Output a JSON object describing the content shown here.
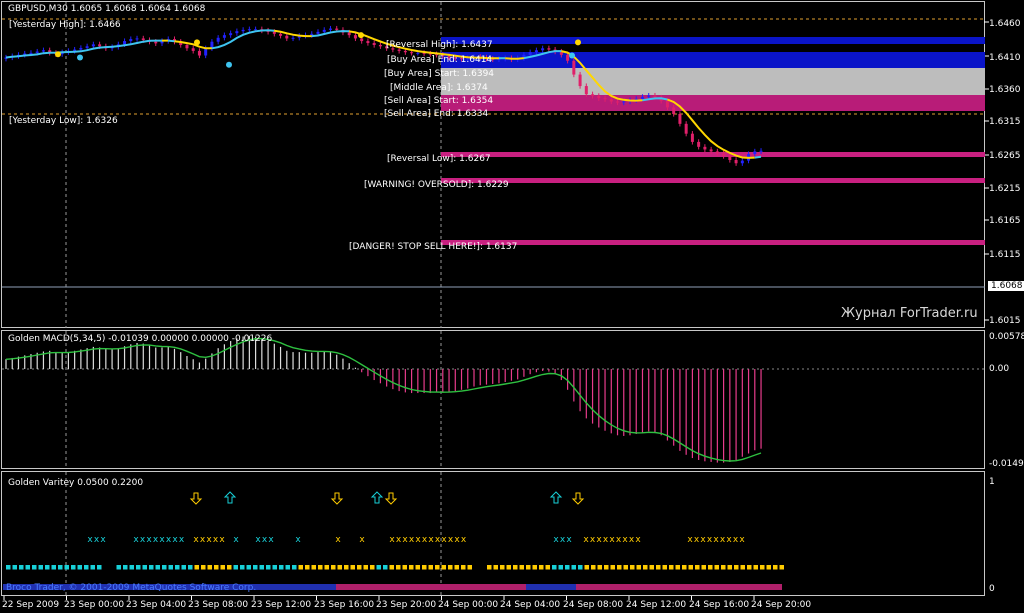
{
  "main_title": "GBPUSD,M30  1.6065 1.6068 1.6064 1.6068",
  "macd_title": "Golden MACD(5,34,5) -0.01039 0.00000 0.00000 -0.01226",
  "variety_title": "Golden Varitey 0.0500 0.2200",
  "watermark": "Журнал ForTrader.ru",
  "copyright": "Broco Trader, © 2001-2009 MetaQuotes Software Corp.",
  "current_price": "1.6068",
  "levels": {
    "yesterday_high": "[Yesterday High]: 1.6466",
    "yesterday_low": "[Yesterday Low]: 1.6326",
    "reversal_high": "[Reversal High]: 1.6437",
    "buy_area_end": "[Buy Area] End: 1.6414",
    "buy_area_start": "[Buy Area] Start: 1.6394",
    "middle_area": "[Middle Area]: 1.6374",
    "sell_area_start": "[Sell Area] Start: 1.6354",
    "sell_area_end": "[Sell Area] End: 1.6334",
    "reversal_low": "[Reversal Low]: 1.6267",
    "warning": "[WARNING! OVERSOLD]: 1.6229",
    "danger": "[DANGER! STOP SELL HERE!]: 1.6137"
  },
  "price_axis": [
    "1.6460",
    "1.6410",
    "1.6360",
    "1.6315",
    "1.6265",
    "1.6215",
    "1.6165",
    "1.6115",
    "1.6015"
  ],
  "macd_axis": [
    "0.00578",
    "0.00",
    "-0.01494"
  ],
  "variety_axis": [
    "1",
    "0"
  ],
  "time_axis": [
    "22 Sep 2009",
    "23 Sep 00:00",
    "23 Sep 04:00",
    "23 Sep 08:00",
    "23 Sep 12:00",
    "23 Sep 16:00",
    "23 Sep 20:00",
    "24 Sep 00:00",
    "24 Sep 04:00",
    "24 Sep 08:00",
    "24 Sep 12:00",
    "24 Sep 16:00",
    "24 Sep 20:00"
  ],
  "colors": {
    "bull": "#2222ff",
    "bear": "#e0206a",
    "ma_yellow": "#ffd700",
    "ma_cyan": "#3ec4f0",
    "macd_pos": "#dddddd",
    "macd_neg": "#e83c8c",
    "signal": "#2ec040",
    "cyan_sq": "#18d0d8",
    "gold_sq": "#ffcc00"
  },
  "chart_data": [
    {
      "type": "candlestick",
      "title": "GBPUSD,M30",
      "ylim": [
        1.6,
        1.648
      ],
      "close": [
        1.6352,
        1.6356,
        1.636,
        1.6364,
        1.6366,
        1.637,
        1.6374,
        1.6366,
        1.6362,
        1.6368,
        1.6372,
        1.6376,
        1.6381,
        1.6386,
        1.6392,
        1.6386,
        1.638,
        1.6384,
        1.6392,
        1.6402,
        1.6408,
        1.641,
        1.6405,
        1.64,
        1.6395,
        1.6402,
        1.6408,
        1.64,
        1.639,
        1.638,
        1.6372,
        1.6358,
        1.638,
        1.64,
        1.6412,
        1.642,
        1.6426,
        1.6432,
        1.6436,
        1.6438,
        1.6438,
        1.6434,
        1.643,
        1.6424,
        1.6418,
        1.641,
        1.6412,
        1.6418,
        1.642,
        1.6424,
        1.643,
        1.6436,
        1.644,
        1.6436,
        1.6428,
        1.642,
        1.641,
        1.6402,
        1.6396,
        1.639,
        1.6386,
        1.638,
        1.6376,
        1.6372,
        1.6368,
        1.6366,
        1.6366,
        1.6364,
        1.6362,
        1.636,
        1.6356,
        1.6352,
        1.635,
        1.6348,
        1.635,
        1.6354,
        1.6352,
        1.6348,
        1.6346,
        1.6348,
        1.635,
        1.6346,
        1.635,
        1.636,
        1.6368,
        1.6374,
        1.638,
        1.6376,
        1.637,
        1.636,
        1.6342,
        1.63,
        1.6265,
        1.624,
        1.6235,
        1.6228,
        1.6225,
        1.6218,
        1.6215,
        1.6218,
        1.6222,
        1.6226,
        1.6232,
        1.6236,
        1.623,
        1.622,
        1.62,
        1.618,
        1.615,
        1.612,
        1.6095,
        1.608,
        1.6072,
        1.6066,
        1.606,
        1.6052,
        1.604,
        1.603,
        1.6038,
        1.6058,
        1.6066,
        1.6068
      ]
    },
    {
      "type": "bar",
      "title": "Golden MACD(5,34,5)",
      "ylim": [
        -0.016,
        0.006
      ],
      "values": [
        0.0015,
        0.0017,
        0.0019,
        0.0021,
        0.0023,
        0.0025,
        0.0027,
        0.0028,
        0.0026,
        0.0025,
        0.0026,
        0.0028,
        0.003,
        0.0032,
        0.0034,
        0.0033,
        0.0031,
        0.003,
        0.0032,
        0.0035,
        0.0038,
        0.004,
        0.0039,
        0.0036,
        0.0033,
        0.0033,
        0.0034,
        0.0031,
        0.0026,
        0.002,
        0.0015,
        0.001,
        0.0016,
        0.0024,
        0.0032,
        0.0038,
        0.0043,
        0.0047,
        0.005,
        0.0051,
        0.005,
        0.0047,
        0.0043,
        0.0039,
        0.0034,
        0.0028,
        0.0026,
        0.0026,
        0.0025,
        0.0025,
        0.0026,
        0.0027,
        0.0026,
        0.0022,
        0.0016,
        0.0009,
        0.0002,
        -0.0005,
        -0.0011,
        -0.0017,
        -0.0022,
        -0.0027,
        -0.0031,
        -0.0034,
        -0.0036,
        -0.0037,
        -0.0037,
        -0.0037,
        -0.0037,
        -0.0036,
        -0.0036,
        -0.0035,
        -0.0034,
        -0.0032,
        -0.003,
        -0.0027,
        -0.0025,
        -0.0024,
        -0.0023,
        -0.0022,
        -0.002,
        -0.0018,
        -0.0016,
        -0.0012,
        -0.0008,
        -0.0005,
        -0.0003,
        -0.0004,
        -0.0008,
        -0.0017,
        -0.0032,
        -0.005,
        -0.0065,
        -0.0076,
        -0.0084,
        -0.009,
        -0.0095,
        -0.0099,
        -0.0102,
        -0.0103,
        -0.0102,
        -0.01,
        -0.0098,
        -0.0096,
        -0.0098,
        -0.0102,
        -0.011,
        -0.0118,
        -0.0126,
        -0.0132,
        -0.0137,
        -0.014,
        -0.0142,
        -0.0143,
        -0.0144,
        -0.0144,
        -0.0143,
        -0.014,
        -0.0135,
        -0.013,
        -0.0125,
        -0.01226
      ]
    }
  ],
  "variety": {
    "up_arrows_x": [
      230,
      377,
      556
    ],
    "down_arrows_x": [
      196,
      337,
      391,
      578
    ],
    "x_marks": [
      {
        "from": 90,
        "to": 104,
        "color": "cyan"
      },
      {
        "from": 136,
        "to": 184,
        "color": "cyan"
      },
      {
        "from": 196,
        "to": 222,
        "color": "gold"
      },
      {
        "from": 236,
        "to": 236,
        "color": "cyan"
      },
      {
        "from": 258,
        "to": 276,
        "color": "cyan"
      },
      {
        "from": 298,
        "to": 298,
        "color": "cyan"
      },
      {
        "from": 338,
        "to": 338,
        "color": "gold"
      },
      {
        "from": 362,
        "to": 362,
        "color": "gold"
      },
      {
        "from": 392,
        "to": 464,
        "color": "gold"
      },
      {
        "from": 556,
        "to": 572,
        "color": "cyan"
      },
      {
        "from": 586,
        "to": 640,
        "color": "gold"
      },
      {
        "from": 690,
        "to": 744,
        "color": "gold"
      }
    ]
  }
}
